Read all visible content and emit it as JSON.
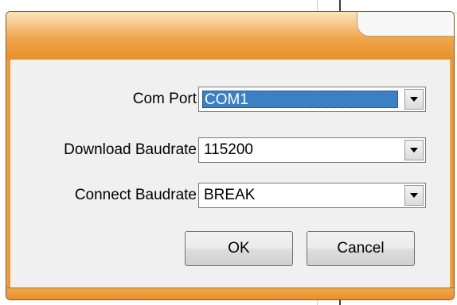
{
  "dialog": {
    "title": "",
    "fields": [
      {
        "label": "Com Port",
        "value": "COM1"
      },
      {
        "label": "Download Baudrate",
        "value": "115200"
      },
      {
        "label": "Connect Baudrate",
        "value": "BREAK"
      }
    ],
    "ok_label": "OK",
    "cancel_label": "Cancel"
  },
  "colors": {
    "titlebar_accent": "#e88f2a",
    "selection": "#3b7fc4"
  }
}
